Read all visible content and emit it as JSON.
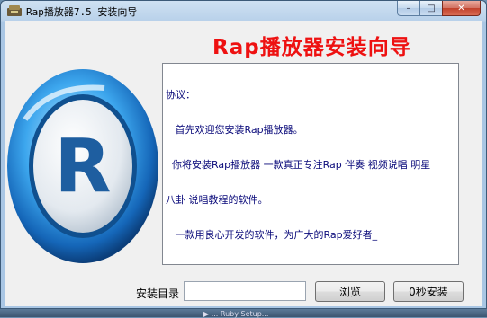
{
  "window": {
    "title": "Rap播放器7.5 安装向导",
    "caption_buttons": {
      "minimize": "–",
      "maximize": "□",
      "close": "✕"
    }
  },
  "heading": "Rap播放器安装向导",
  "agreement": {
    "lines": [
      "协议：",
      "   首先欢迎您安装Rap播放器。",
      "  你将安装Rap播放器 一款真正专注Rap 伴奏 视频说唱 明星",
      "八卦 说唱教程的软件。",
      "   一款用良心开发的软件，为广大的Rap爱好者_"
    ]
  },
  "install_dir": {
    "label": "安装目录",
    "value": ""
  },
  "buttons": {
    "browse": "浏览",
    "install": "0秒安装"
  },
  "logo": {
    "letter": "R"
  },
  "taskbar": {
    "item": "▶ ... Ruby Setup..."
  },
  "colors": {
    "heading": "#ee1111",
    "agreement_text": "#0a0a7a"
  }
}
